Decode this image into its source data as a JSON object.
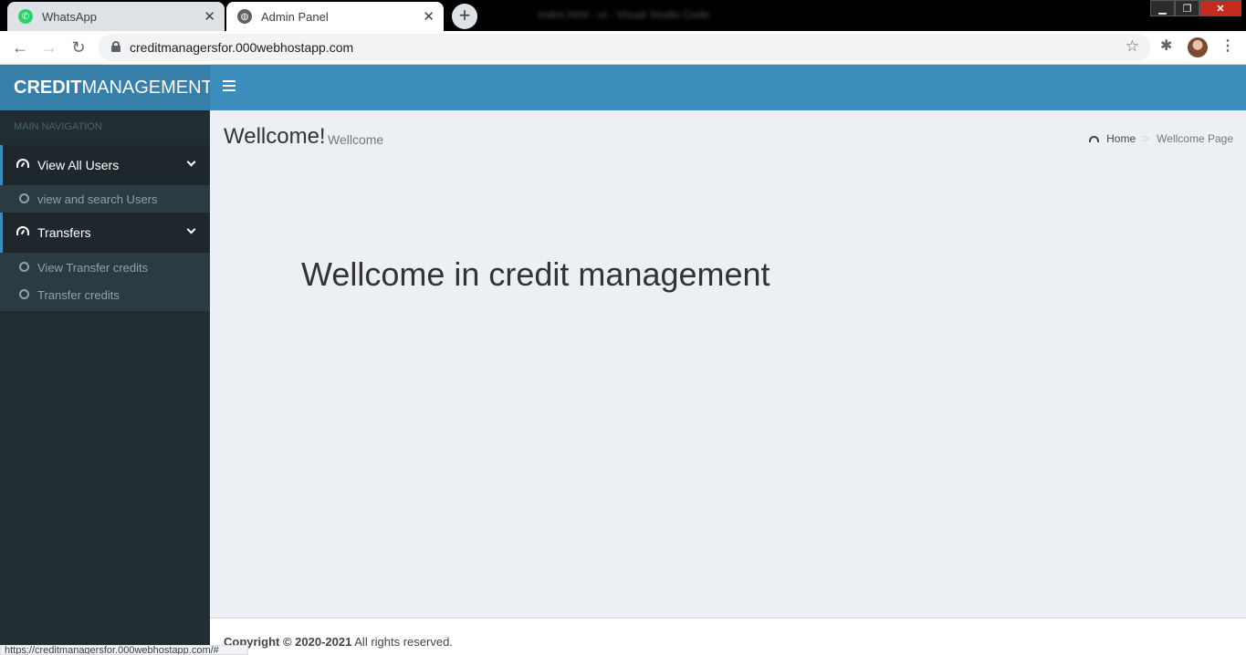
{
  "browser": {
    "tabs": [
      {
        "title": "WhatsApp",
        "icon": "whatsapp-icon"
      },
      {
        "title": "Admin Panel",
        "icon": "globe-icon"
      }
    ],
    "window_title": "index.html - ui - Visual Studio Code",
    "url": "creditmanagersfor.000webhostapp.com",
    "status_url": "https://creditmanagersfor.000webhostapp.com/#"
  },
  "app": {
    "logo_bold": "CREDIT",
    "logo_light": "MANAGEMENT"
  },
  "sidebar": {
    "header": "MAIN NAVIGATION",
    "menus": [
      {
        "label": "View All Users",
        "items": [
          {
            "label": "view and search Users"
          }
        ]
      },
      {
        "label": "Transfers",
        "items": [
          {
            "label": "View Transfer credits"
          },
          {
            "label": "Transfer credits"
          }
        ]
      }
    ]
  },
  "content": {
    "title": "Wellcome!",
    "subtitle": "Wellcome",
    "breadcrumb": {
      "home": "Home",
      "current": "Wellcome Page"
    },
    "hero": "Wellcome in credit management"
  },
  "footer": {
    "copyright": "Copyright © 2020-2021",
    "rights": "All rights reserved."
  },
  "colors": {
    "header_blue": "#3c8dbc",
    "logo_blue": "#367fa9",
    "sidebar_dark": "#222d32",
    "content_bg": "#ecf0f5"
  }
}
